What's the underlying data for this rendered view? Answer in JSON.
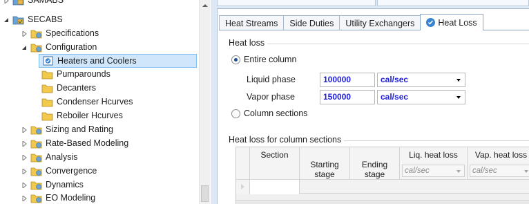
{
  "tree": {
    "items": [
      {
        "label": "SAMABS",
        "expanded": false,
        "level": 0,
        "cut": true
      },
      {
        "label": "SECABS",
        "expanded": true,
        "level": 0
      },
      {
        "label": "Specifications",
        "expanded": false,
        "level": 1
      },
      {
        "label": "Configuration",
        "expanded": true,
        "level": 1
      },
      {
        "label": "Heaters and Coolers",
        "level": 2,
        "selected": true
      },
      {
        "label": "Pumparounds",
        "level": 2
      },
      {
        "label": "Decanters",
        "level": 2
      },
      {
        "label": "Condenser Hcurves",
        "level": 2
      },
      {
        "label": "Reboiler Hcurves",
        "level": 2
      },
      {
        "label": "Sizing and Rating",
        "expanded": false,
        "level": 1
      },
      {
        "label": "Rate-Based Modeling",
        "expanded": false,
        "level": 1
      },
      {
        "label": "Analysis",
        "expanded": false,
        "level": 1
      },
      {
        "label": "Convergence",
        "expanded": false,
        "level": 1
      },
      {
        "label": "Dynamics",
        "expanded": false,
        "level": 1
      },
      {
        "label": "EO Modeling",
        "expanded": false,
        "level": 1
      }
    ]
  },
  "tabs": [
    {
      "label": "Heat Streams",
      "active": false
    },
    {
      "label": "Side Duties",
      "active": false
    },
    {
      "label": "Utility Exchangers",
      "active": false
    },
    {
      "label": "Heat Loss",
      "active": true,
      "checked": true
    }
  ],
  "heat_loss": {
    "group_title": "Heat loss",
    "option_entire": "Entire column",
    "option_sections": "Column sections",
    "selected_option": "entire",
    "liquid": {
      "label": "Liquid phase",
      "value": "100000",
      "unit": "cal/sec"
    },
    "vapor": {
      "label": "Vapor phase",
      "value": "150000",
      "unit": "cal/sec"
    }
  },
  "sections_table": {
    "group_title": "Heat loss for column sections",
    "columns": [
      {
        "label": "Section",
        "unit": ""
      },
      {
        "label": "Starting\nstage",
        "unit": ""
      },
      {
        "label": "Ending\nstage",
        "unit": ""
      },
      {
        "label": "Liq. heat loss",
        "unit": "cal/sec"
      },
      {
        "label": "Vap. heat loss",
        "unit": "cal/sec"
      }
    ]
  },
  "colors": {
    "selection_bg": "#cfe6fb",
    "value_text": "#1d1ddb",
    "tab_check": "#3a83d0",
    "folder_yellow": "#f2c94c",
    "folder_blue": "#6aa3d8"
  },
  "icons": {
    "folder": "folder-icon",
    "block_folder": "block-folder-icon",
    "form": "form-icon",
    "expand": "triangle-right-icon",
    "collapse": "triangle-down-icon",
    "check": "check-circle-icon"
  }
}
